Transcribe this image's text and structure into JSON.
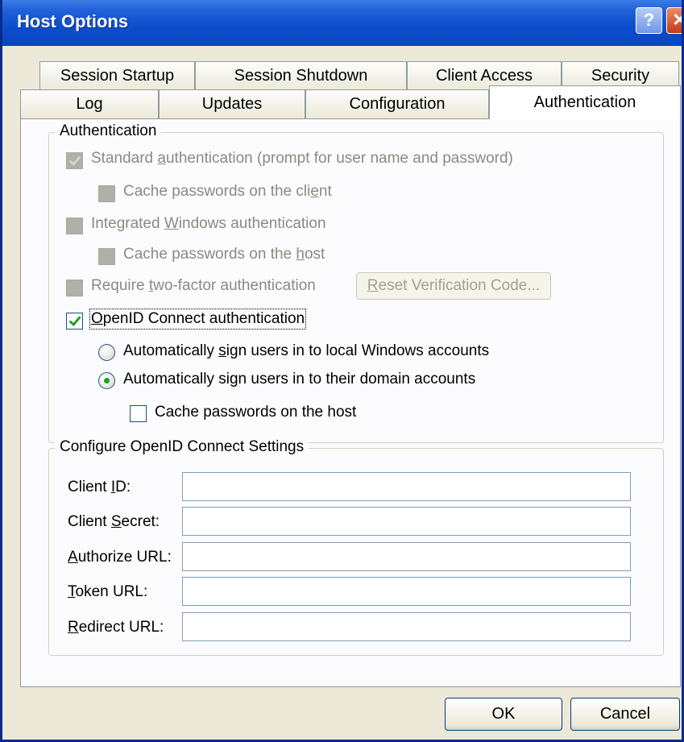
{
  "window": {
    "title": "Host Options",
    "help": "?",
    "close": "✕"
  },
  "tabs_row1": [
    "Session Startup",
    "Session Shutdown",
    "Client Access",
    "Security"
  ],
  "tabs_row2": [
    "Log",
    "Updates",
    "Configuration",
    "Authentication"
  ],
  "active_tab": "Authentication",
  "auth_group": {
    "legend": "Authentication",
    "standard": {
      "pre": "Standard ",
      "key": "a",
      "post": "uthentication (prompt for user name and password)",
      "checked": true,
      "enabled": false
    },
    "cache_client": {
      "pre": "Cache passwords on the cli",
      "key": "e",
      "post": "nt",
      "checked": false,
      "enabled": false
    },
    "integrated": {
      "pre": "Integrated ",
      "key": "W",
      "post": "indows authentication",
      "checked": false,
      "enabled": false
    },
    "cache_host_1": {
      "pre": "Cache passwords on the ",
      "key": "h",
      "post": "ost",
      "checked": false,
      "enabled": false
    },
    "two_factor": {
      "pre": "Require ",
      "key": "t",
      "post": "wo-factor authentication",
      "checked": false,
      "enabled": false
    },
    "reset_button": {
      "pre": "",
      "key": "R",
      "post": "eset Verification Code..."
    },
    "openid": {
      "pre": "",
      "key": "O",
      "post": "penID Connect authentication",
      "checked": true
    },
    "radio_local": {
      "pre": "Automatically ",
      "key": "s",
      "post": "ign users in to local Windows accounts",
      "checked": false
    },
    "radio_domain": {
      "pre": "Automatically sign users in to their domain accounts",
      "checked": true
    },
    "cache_host_2": {
      "label": "Cache passwords on the host",
      "checked": false
    }
  },
  "oidc_group": {
    "legend": "Configure OpenID Connect Settings",
    "fields": [
      {
        "pre": "Client ",
        "key": "I",
        "post": "D:",
        "value": ""
      },
      {
        "pre": "Client ",
        "key": "S",
        "post": "ecret:",
        "value": ""
      },
      {
        "pre": "",
        "key": "A",
        "post": "uthorize URL:",
        "value": ""
      },
      {
        "pre": "",
        "key": "T",
        "post": "oken URL:",
        "value": ""
      },
      {
        "pre": "",
        "key": "R",
        "post": "edirect URL:",
        "value": ""
      }
    ]
  },
  "buttons": {
    "ok": "OK",
    "cancel": "Cancel"
  }
}
